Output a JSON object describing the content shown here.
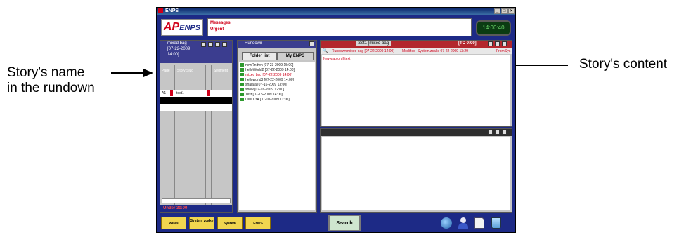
{
  "annotations": {
    "left_line1": "Story's name",
    "left_line2": "in the rundown",
    "right": "Story's content"
  },
  "window": {
    "title": "ENPS",
    "controls": [
      "_",
      "□",
      "×"
    ]
  },
  "header": {
    "logo_ap": "AP",
    "logo_enps": "ENPS",
    "message_label": "Messages",
    "urgent_label": "Urgent",
    "clock": "14:00:40"
  },
  "rundown_panel": {
    "title_line1": "mixed bag",
    "title_line2": "[07-22-2009",
    "title_line3": "14:00]",
    "columns": [
      "Page",
      "Story Slug",
      "Segment"
    ],
    "rows": [
      {
        "page": "A1",
        "slug": "test1",
        "segment": ""
      }
    ],
    "footer_status": "Under 30:00"
  },
  "rundown_list_panel": {
    "title": "Rundown",
    "tabs": [
      "Folder list",
      "My ENPS"
    ],
    "items": [
      {
        "label": "newRndwn [07-23-2009 15:00]",
        "highlight": false
      },
      {
        "label": "helloWorld2 [07-22-2009 14:00]",
        "highlight": false
      },
      {
        "label": "mixed bag [07-22-2009 14:00]",
        "highlight": true
      },
      {
        "label": "helloworld3 [07-22-2009 14:00]",
        "highlight": false
      },
      {
        "label": "shalala [07-16-2009 13:00]",
        "highlight": false
      },
      {
        "label": "show [07-16-2009 12:00]",
        "highlight": false
      },
      {
        "label": "Test [07-15-2009 14:00]",
        "highlight": false
      },
      {
        "label": "DWO 3A [07-10-2009 11:00]",
        "highlight": false
      }
    ]
  },
  "story_panel": {
    "title": "test1 [mixed bag",
    "timecode": "[TC 0:00]",
    "info_rundown": "Rundown",
    "info_rundown_value": "mixed bag [07-22-2009 14:00]",
    "info_modified": "Modified",
    "info_modified_value": "System.zcake  07-22-2009 13:29",
    "info_from": "From",
    "info_from_value": "Sys",
    "body_text": "[www.ap.org] text"
  },
  "bottom_bar": {
    "folders": [
      "Wires",
      "System zcake",
      "System",
      "ENPS"
    ],
    "search_label": "Search",
    "icons": [
      "globe-icon",
      "people-icon",
      "document-icon",
      "trash-icon"
    ]
  },
  "colors": {
    "app_bg": "#1d2a86",
    "accent_red": "#d0001a",
    "panel_gray": "#c6c6c6",
    "story_header_red": "#b3272d",
    "folder_yellow": "#f1d64f"
  }
}
